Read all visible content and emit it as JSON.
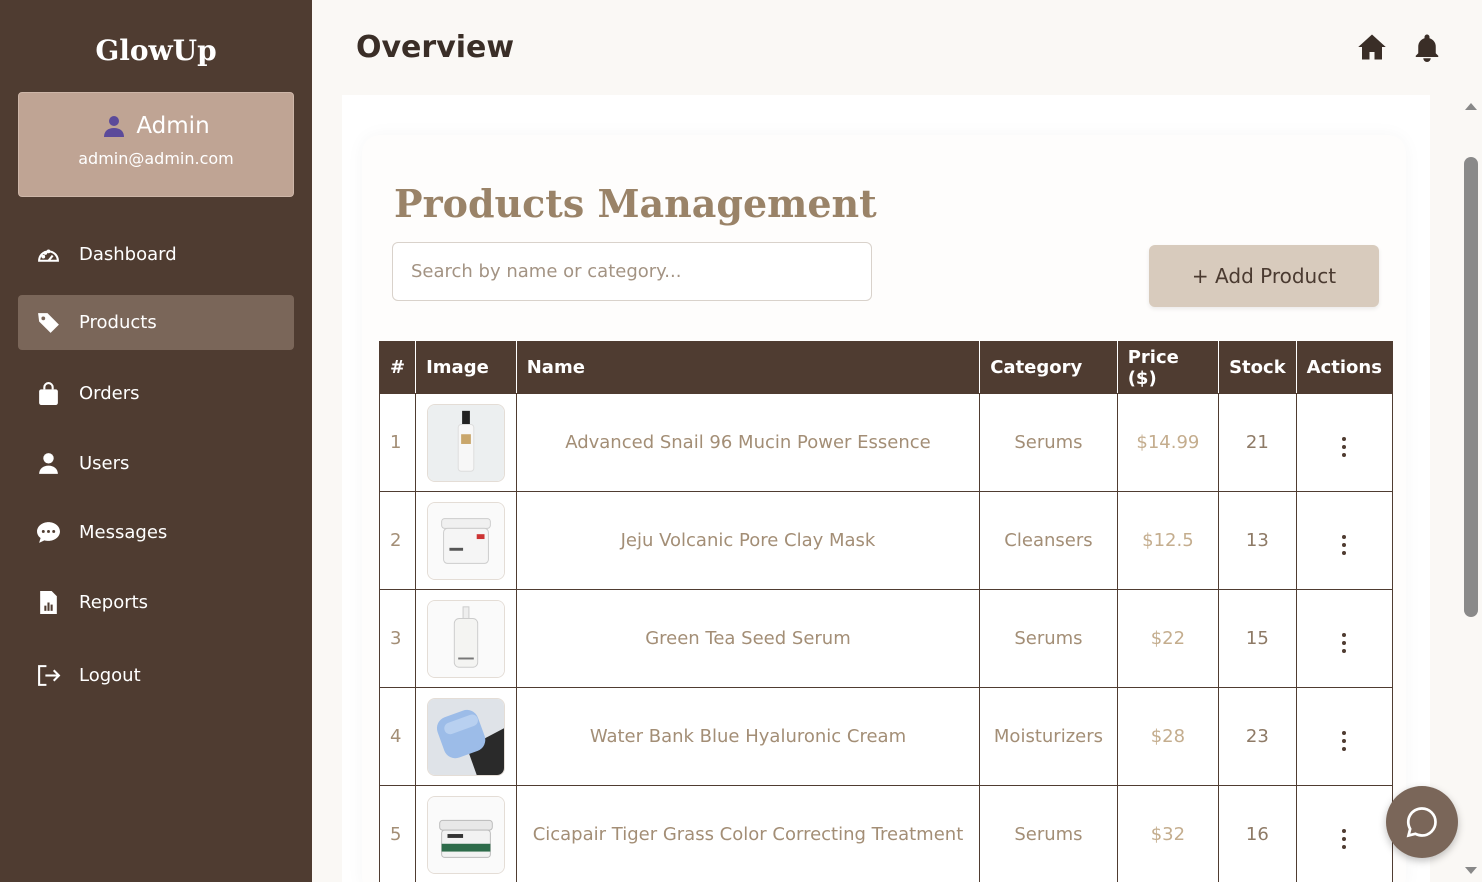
{
  "sidebar": {
    "brand": "GlowUp",
    "admin": {
      "name": "Admin",
      "email": "admin@admin.com"
    },
    "items": [
      {
        "label": "Dashboard",
        "icon": "gauge-icon"
      },
      {
        "label": "Products",
        "icon": "tag-icon",
        "active": true
      },
      {
        "label": "Orders",
        "icon": "shopping-bag-icon"
      },
      {
        "label": "Users",
        "icon": "user-icon"
      },
      {
        "label": "Messages",
        "icon": "chat-bubble-icon"
      },
      {
        "label": "Reports",
        "icon": "report-icon"
      },
      {
        "label": "Logout",
        "icon": "logout-icon"
      }
    ]
  },
  "header": {
    "title": "Overview"
  },
  "main": {
    "section_title": "Products Management",
    "search": {
      "placeholder": "Search by name or category...",
      "value": ""
    },
    "add_button": "+ Add Product",
    "table": {
      "columns": [
        "#",
        "Image",
        "Name",
        "Category",
        "Price ($)",
        "Stock",
        "Actions"
      ],
      "rows": [
        {
          "idx": "1",
          "name": "Advanced Snail 96 Mucin Power Essence",
          "category": "Serums",
          "price": "$14.99",
          "stock": "21"
        },
        {
          "idx": "2",
          "name": "Jeju Volcanic Pore Clay Mask",
          "category": "Cleansers",
          "price": "$12.5",
          "stock": "13"
        },
        {
          "idx": "3",
          "name": "Green Tea Seed Serum",
          "category": "Serums",
          "price": "$22",
          "stock": "15"
        },
        {
          "idx": "4",
          "name": "Water Bank Blue Hyaluronic Cream",
          "category": "Moisturizers",
          "price": "$28",
          "stock": "23"
        },
        {
          "idx": "5",
          "name": "Cicapair Tiger Grass Color Correcting Treatment",
          "category": "Serums",
          "price": "$32",
          "stock": "16"
        }
      ]
    }
  },
  "colors": {
    "sidebar": "#4f3c31",
    "active": "#7a6659",
    "accent": "#9a8368",
    "button": "#d8cbbd"
  }
}
